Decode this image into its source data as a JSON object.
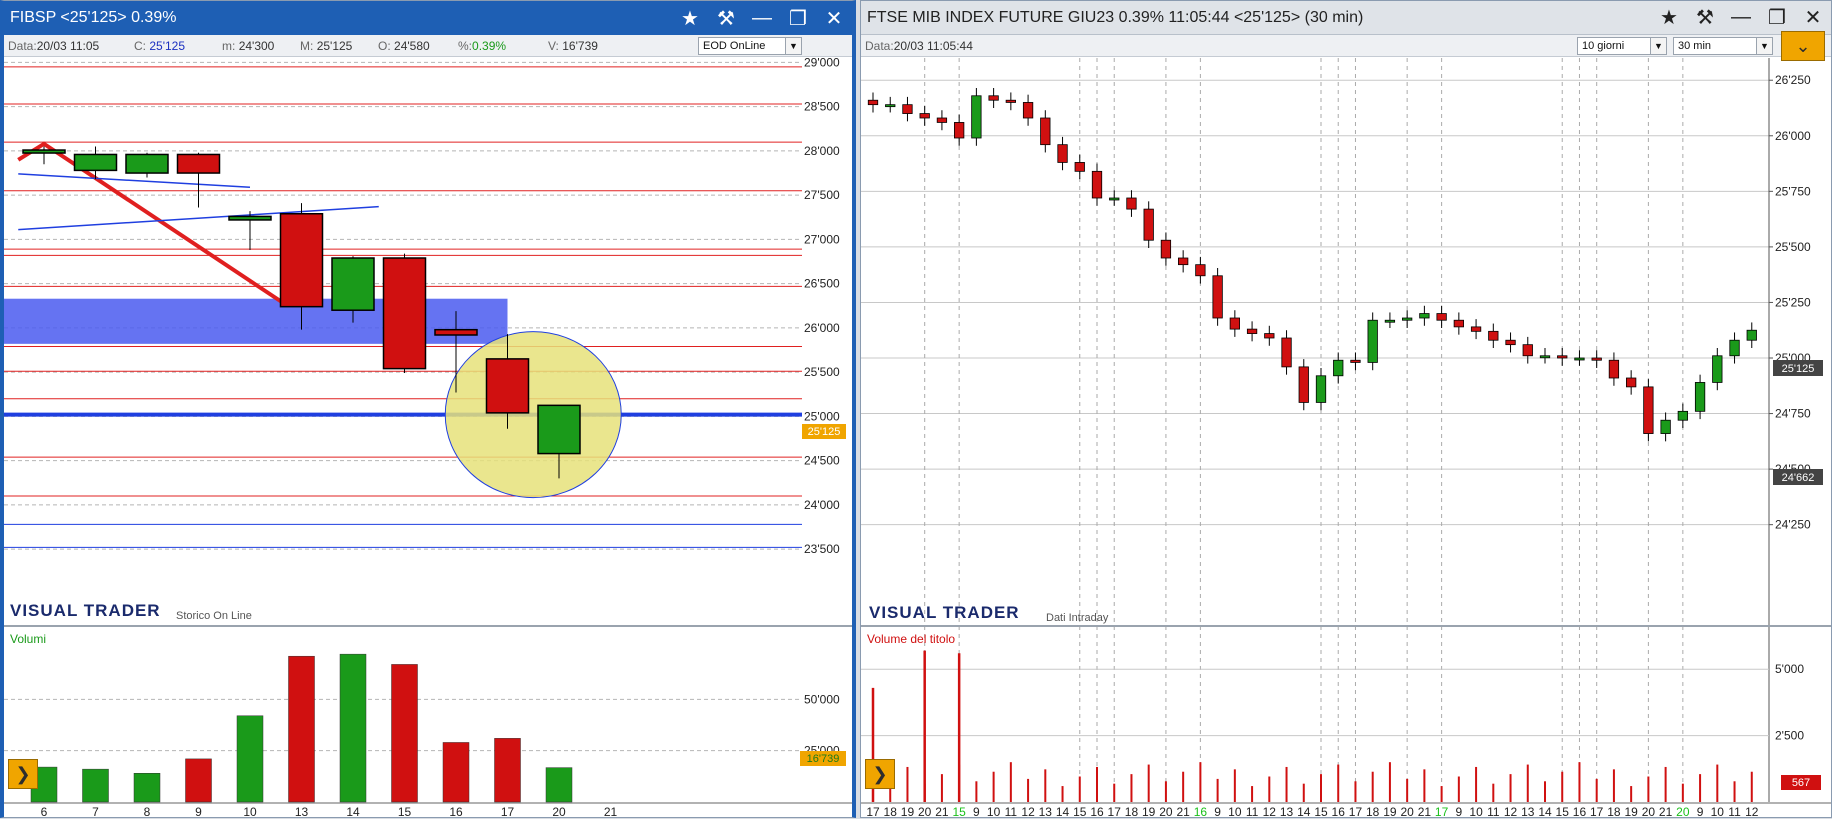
{
  "left": {
    "title": "FIBSP <25'125> 0.39%",
    "info": {
      "data_label": "Data:",
      "data_value": "20/03 11:05",
      "c_label": "C:",
      "c_value": "25'125",
      "m_label": "m:",
      "m_value": "24'300",
      "M_label": "M:",
      "M_value": "25'125",
      "o_label": "O:",
      "o_value": "24'580",
      "pct_label": "%:",
      "pct_value": "0.39%",
      "v_label": "V:",
      "v_value": "16'739"
    },
    "mode_select": "EOD OnLine",
    "brand": "VISUAL TRADER",
    "brand_sub": "Storico On Line",
    "volume_label": "Volumi",
    "last_price_tag": "25'125",
    "last_volume_tag": "16'739",
    "colors": {
      "up": "#1a9a1a",
      "down": "#d01010",
      "trend": "#e02020",
      "support": "#1f3fe0",
      "zone": "#4a5af0",
      "highlight": "#e6e27a",
      "price_tag": "#f0a500",
      "volume_tag": "#f0a500"
    }
  },
  "right": {
    "title": "FTSE MIB INDEX FUTURE GIU23 0.39% 11:05:44  <25'125> (30 min)",
    "info": {
      "data_label": "Data:",
      "data_value": "20/03 11:05:44"
    },
    "period_select": "10 giorni",
    "interval_select": "30 min",
    "brand": "VISUAL TRADER",
    "brand_sub": "Dati Intraday",
    "volume_label": "Volume del titolo",
    "last_price_tag": "25'125",
    "min_price_tag": "24'662",
    "last_volume_tag": "567",
    "colors": {
      "up": "#1a9a1a",
      "down": "#d01010",
      "price_tag": "#444444",
      "volume_tag": "#d01010"
    }
  },
  "chart_data": [
    {
      "type": "candlestick",
      "name": "FIBSP daily",
      "categories": [
        "6",
        "7",
        "8",
        "9",
        "10",
        "13",
        "14",
        "15",
        "16",
        "17",
        "20",
        "21"
      ],
      "ohlc": [
        [
          28000,
          28050,
          27850,
          28010
        ],
        [
          27780,
          28050,
          27680,
          27960
        ],
        [
          27750,
          27980,
          27700,
          27960
        ],
        [
          27960,
          27980,
          27360,
          27750
        ],
        [
          27220,
          27320,
          26880,
          27260
        ],
        [
          27290,
          27410,
          25980,
          26240
        ],
        [
          26200,
          26810,
          26060,
          26790
        ],
        [
          26790,
          26840,
          25490,
          25540
        ],
        [
          25980,
          26190,
          25270,
          25920
        ],
        [
          25650,
          25930,
          24860,
          25040
        ],
        [
          24580,
          25125,
          24300,
          25125
        ],
        null
      ],
      "y_ticks": [
        "29'000",
        "28'500",
        "28'000",
        "27'500",
        "27'000",
        "26'500",
        "26'000",
        "25'500",
        "25'000",
        "24'500",
        "24'000",
        "23'500"
      ],
      "ylim": [
        23400,
        29050
      ],
      "volumes": [
        17000,
        16000,
        14000,
        21000,
        42000,
        71000,
        72000,
        67000,
        29000,
        31000,
        16739,
        0
      ],
      "volume_ticks": [
        "50'000",
        "25'000"
      ],
      "volume_ylim": [
        0,
        75000
      ],
      "support_lines": [
        25020
      ],
      "resistance_lines": [
        28950,
        28530,
        28100,
        27550,
        26890,
        26820,
        26470,
        25790,
        25510,
        25200,
        24540,
        24100
      ],
      "blue_lines": [
        23780,
        23520
      ],
      "zone": [
        25820,
        26330
      ],
      "trendline": [
        [
          -0.5,
          27900
        ],
        [
          0.0,
          28080
        ],
        [
          4.6,
          26300
        ]
      ],
      "blue_trendlines": [
        [
          [
            -0.5,
            27740
          ],
          [
            4.0,
            27590
          ]
        ],
        [
          [
            -0.5,
            27110
          ],
          [
            6.5,
            27370
          ]
        ]
      ]
    },
    {
      "type": "candlestick",
      "name": "FTSE MIB INDEX FUTURE GIU23 30 min",
      "x_labels": [
        "17",
        "18",
        "19",
        "20",
        "21",
        "15",
        "9",
        "10",
        "11",
        "12",
        "13",
        "14",
        "15",
        "16",
        "17",
        "18",
        "19",
        "20",
        "21",
        "16",
        "9",
        "10",
        "11",
        "12",
        "13",
        "14",
        "15",
        "16",
        "17",
        "18",
        "19",
        "20",
        "21",
        "17",
        "9",
        "10",
        "11",
        "12",
        "13",
        "14",
        "15",
        "16",
        "17",
        "18",
        "19",
        "20",
        "21",
        "20",
        "9",
        "10",
        "11",
        "12"
      ],
      "highlight_labels": [
        "15",
        "16",
        "17",
        "20"
      ],
      "close_series": [
        26140,
        26140,
        26100,
        26080,
        26060,
        25990,
        26180,
        26160,
        26150,
        26080,
        25960,
        25880,
        25840,
        25720,
        25720,
        25670,
        25530,
        25450,
        25420,
        25370,
        25180,
        25130,
        25110,
        25090,
        24960,
        24800,
        24920,
        24990,
        24980,
        25170,
        25170,
        25180,
        25200,
        25170,
        25140,
        25120,
        25080,
        25060,
        25010,
        25010,
        25000,
        25000,
        24990,
        24910,
        24870,
        24660,
        24720,
        24760,
        24890,
        25010,
        25080,
        25125
      ],
      "y_ticks": [
        "26'250",
        "26'000",
        "25'750",
        "25'500",
        "25'250",
        "25'000",
        "24'750",
        "24'500",
        "24'250"
      ],
      "ylim": [
        24100,
        26350
      ],
      "volume_ticks": [
        "5'000",
        "2'500"
      ],
      "volume_ylim": [
        0,
        5800
      ],
      "volume_spikes": [
        {
          "at": "15",
          "value": 5600
        },
        {
          "at": "17",
          "value": 4300
        },
        {
          "at": "20",
          "value": 5700
        }
      ]
    }
  ]
}
